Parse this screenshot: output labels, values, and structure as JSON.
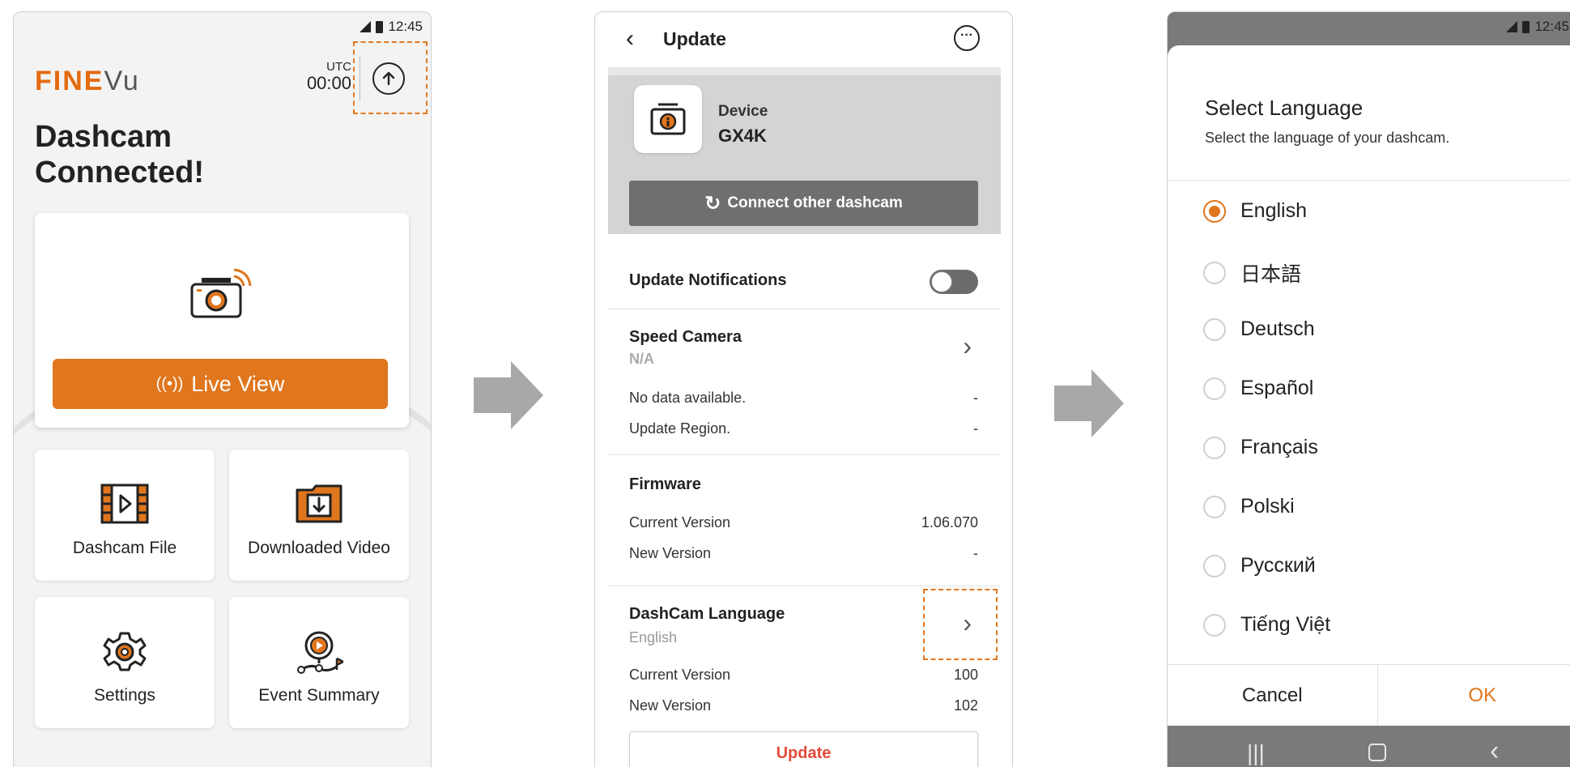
{
  "screen1": {
    "status_time": "12:45",
    "logo_fine": "FINE",
    "logo_vu": "Vu",
    "utc_label": "UTC",
    "utc_time": "00:00",
    "title": "Dashcam Connected!",
    "live_view_label": "Live View",
    "tiles": [
      {
        "label": "Dashcam File",
        "icon": "film-icon"
      },
      {
        "label": "Downloaded Video",
        "icon": "download-folder-icon"
      },
      {
        "label": "Settings",
        "icon": "gear-icon"
      },
      {
        "label": "Event Summary",
        "icon": "event-summary-icon"
      }
    ]
  },
  "screen2": {
    "title": "Update",
    "device_label": "Device",
    "device_name": "GX4K",
    "connect_label": "Connect other dashcam",
    "update_notifications_label": "Update Notifications",
    "update_notifications_on": false,
    "speed_camera": {
      "title": "Speed Camera",
      "status": "N/A",
      "rows": [
        {
          "key": "No data available.",
          "value": "-"
        },
        {
          "key": "Update Region.",
          "value": "-"
        }
      ]
    },
    "firmware": {
      "title": "Firmware",
      "rows": [
        {
          "key": "Current Version",
          "value": "1.06.070"
        },
        {
          "key": "New Version",
          "value": "-"
        }
      ]
    },
    "language": {
      "title": "DashCam Language",
      "current": "English",
      "rows": [
        {
          "key": "Current Version",
          "value": "100"
        },
        {
          "key": "New Version",
          "value": "102"
        }
      ]
    },
    "update_button": "Update"
  },
  "screen3": {
    "status_time": "12:45",
    "title": "Select Language",
    "subtitle": "Select the language of your dashcam.",
    "languages": [
      {
        "label": "English",
        "selected": true
      },
      {
        "label": "日本語",
        "selected": false
      },
      {
        "label": "Deutsch",
        "selected": false
      },
      {
        "label": "Español",
        "selected": false
      },
      {
        "label": "Français",
        "selected": false
      },
      {
        "label": "Polski",
        "selected": false
      },
      {
        "label": "Русский",
        "selected": false
      },
      {
        "label": "Tiếng Việt",
        "selected": false
      }
    ],
    "cancel_label": "Cancel",
    "ok_label": "OK"
  },
  "colors": {
    "accent": "#e0761d",
    "highlight": "#e4781e",
    "update_red": "#e44a3a"
  }
}
